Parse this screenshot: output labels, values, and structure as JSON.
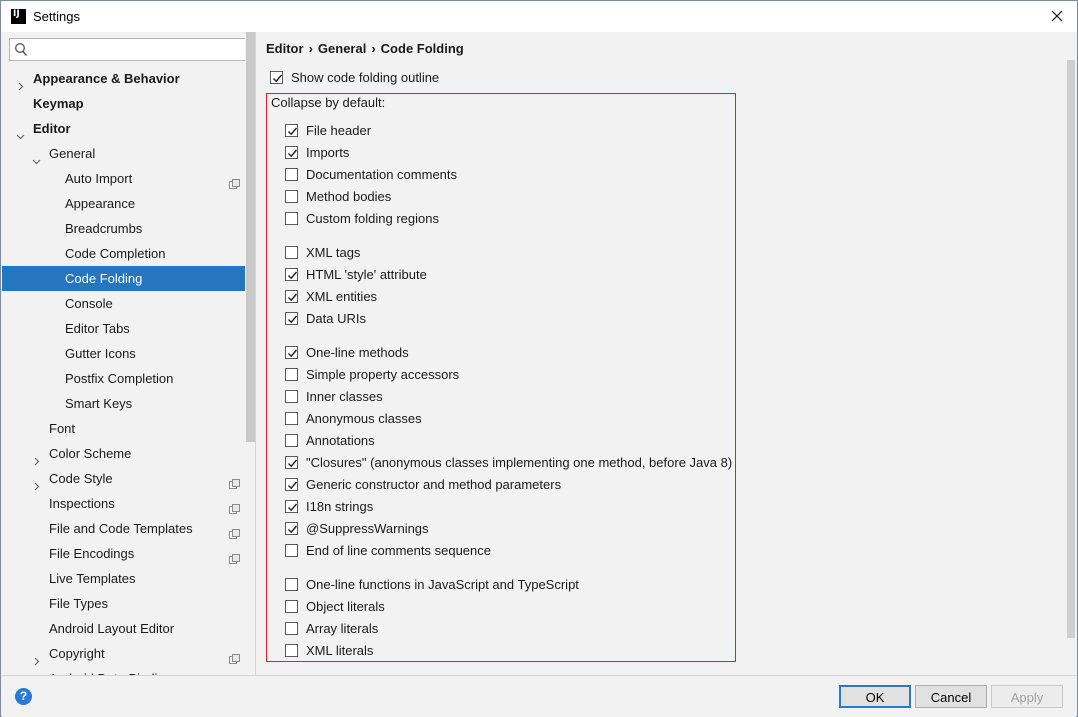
{
  "window": {
    "title": "Settings",
    "app_icon_text": "IJ"
  },
  "search": {
    "value": "",
    "placeholder": ""
  },
  "sidebar": {
    "items": [
      {
        "label": "Appearance & Behavior",
        "bold": true,
        "arrow": "right"
      },
      {
        "label": "Keymap",
        "bold": true
      },
      {
        "label": "Editor",
        "bold": true,
        "arrow": "down"
      },
      {
        "label": "General",
        "arrow": "down"
      },
      {
        "label": "Auto Import",
        "project_icon": true
      },
      {
        "label": "Appearance"
      },
      {
        "label": "Breadcrumbs"
      },
      {
        "label": "Code Completion"
      },
      {
        "label": "Code Folding",
        "selected": true
      },
      {
        "label": "Console"
      },
      {
        "label": "Editor Tabs"
      },
      {
        "label": "Gutter Icons"
      },
      {
        "label": "Postfix Completion"
      },
      {
        "label": "Smart Keys"
      },
      {
        "label": "Font"
      },
      {
        "label": "Color Scheme",
        "arrow": "right"
      },
      {
        "label": "Code Style",
        "arrow": "right",
        "project_icon": true
      },
      {
        "label": "Inspections",
        "project_icon": true
      },
      {
        "label": "File and Code Templates",
        "project_icon": true
      },
      {
        "label": "File Encodings",
        "project_icon": true
      },
      {
        "label": "Live Templates"
      },
      {
        "label": "File Types"
      },
      {
        "label": "Android Layout Editor"
      },
      {
        "label": "Copyright",
        "arrow": "right",
        "project_icon": true
      },
      {
        "label": "Android Data Binding"
      }
    ]
  },
  "breadcrumb": {
    "parts": [
      "Editor",
      "General",
      "Code Folding"
    ],
    "separator": "›"
  },
  "show_outline": {
    "label": "Show code folding outline",
    "checked": true
  },
  "collapse": {
    "title": "Collapse by default:",
    "groups": [
      [
        {
          "label": "File header",
          "checked": true
        },
        {
          "label": "Imports",
          "checked": true
        },
        {
          "label": "Documentation comments",
          "checked": false
        },
        {
          "label": "Method bodies",
          "checked": false
        },
        {
          "label": "Custom folding regions",
          "checked": false
        }
      ],
      [
        {
          "label": "XML tags",
          "checked": false
        },
        {
          "label": "HTML 'style' attribute",
          "checked": true
        },
        {
          "label": "XML entities",
          "checked": true
        },
        {
          "label": "Data URIs",
          "checked": true
        }
      ],
      [
        {
          "label": "One-line methods",
          "checked": true
        },
        {
          "label": "Simple property accessors",
          "checked": false
        },
        {
          "label": "Inner classes",
          "checked": false
        },
        {
          "label": "Anonymous classes",
          "checked": false
        },
        {
          "label": "Annotations",
          "checked": false
        },
        {
          "label": "\"Closures\" (anonymous classes implementing one method, before Java 8)",
          "checked": true
        },
        {
          "label": "Generic constructor and method parameters",
          "checked": true
        },
        {
          "label": "I18n strings",
          "checked": true
        },
        {
          "label": "@SuppressWarnings",
          "checked": true
        },
        {
          "label": "End of line comments sequence",
          "checked": false
        }
      ],
      [
        {
          "label": "One-line functions in JavaScript and TypeScript",
          "checked": false
        },
        {
          "label": "Object literals",
          "checked": false
        },
        {
          "label": "Array literals",
          "checked": false
        },
        {
          "label": "XML literals",
          "checked": false
        }
      ]
    ]
  },
  "footer": {
    "help_label": "?",
    "ok_label": "OK",
    "cancel_label": "Cancel",
    "apply_label": "Apply"
  },
  "colors": {
    "selection": "#2675bf",
    "highlight_border": "#e0202a",
    "help_icon": "#2b7bd4"
  }
}
